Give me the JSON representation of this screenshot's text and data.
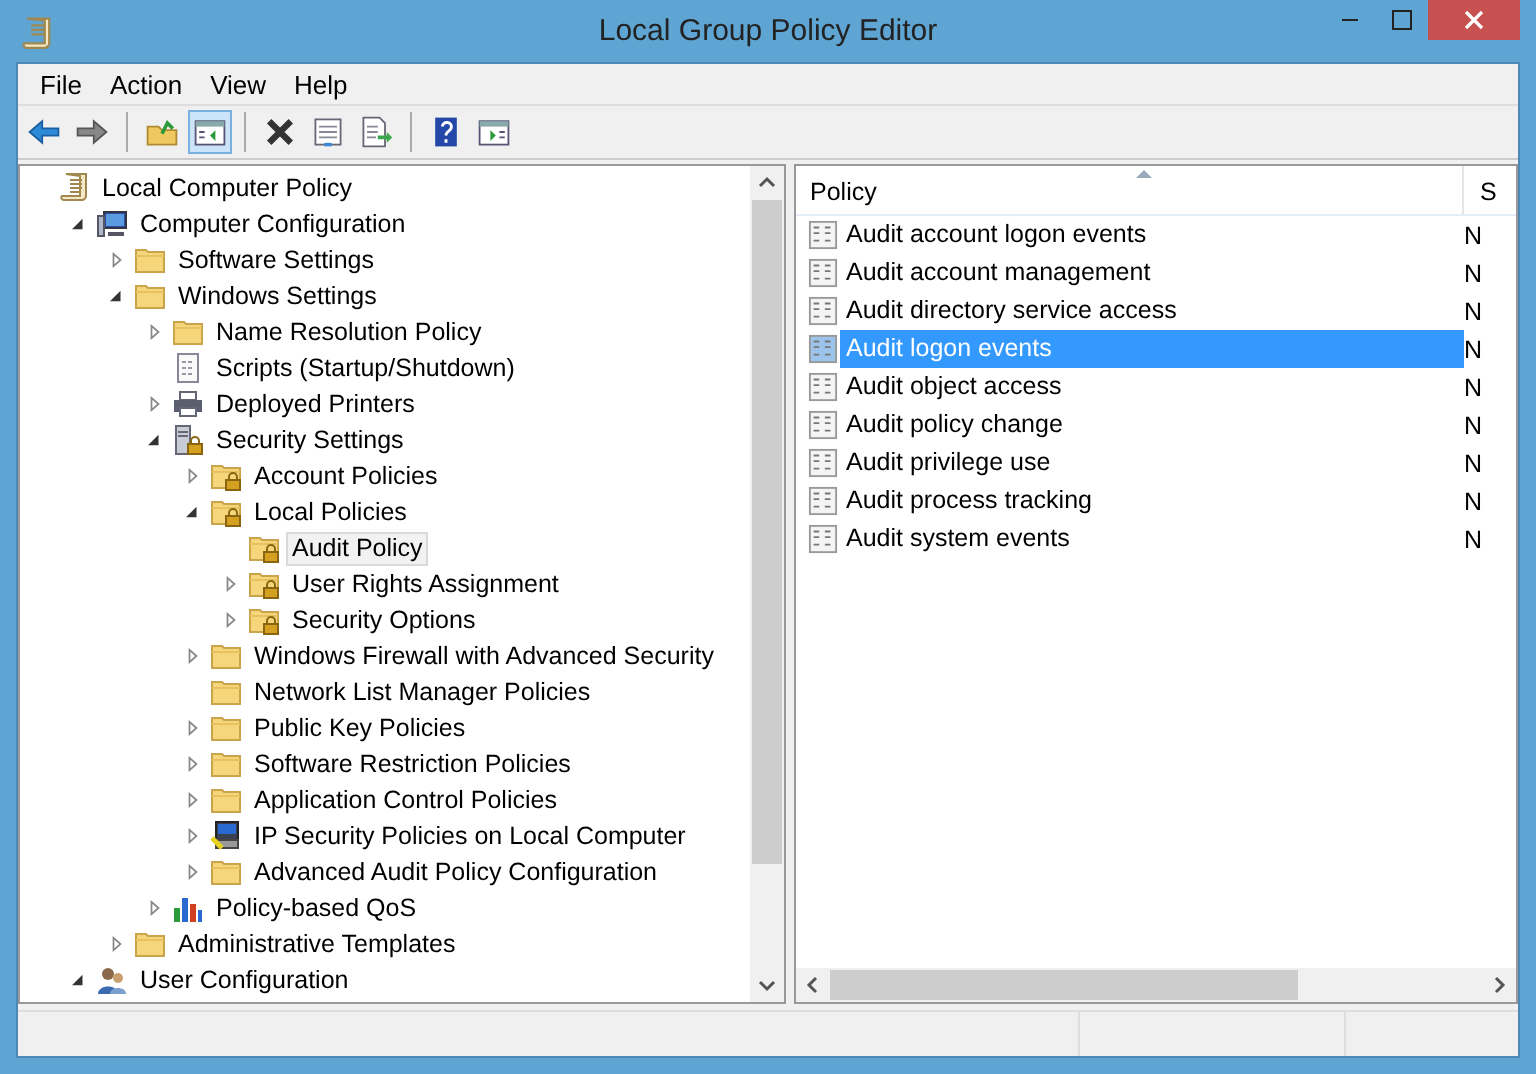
{
  "window": {
    "title": "Local Group Policy Editor"
  },
  "menu": [
    "File",
    "Action",
    "View",
    "Help"
  ],
  "toolbar": [
    {
      "kind": "back",
      "pressed": false
    },
    {
      "kind": "forward",
      "pressed": false
    },
    {
      "kind": "sep"
    },
    {
      "kind": "up",
      "pressed": false
    },
    {
      "kind": "tree",
      "pressed": true
    },
    {
      "kind": "sep"
    },
    {
      "kind": "delete",
      "pressed": false
    },
    {
      "kind": "properties",
      "pressed": false
    },
    {
      "kind": "export",
      "pressed": false
    },
    {
      "kind": "sep"
    },
    {
      "kind": "help",
      "pressed": false
    },
    {
      "kind": "action-pane",
      "pressed": false
    }
  ],
  "tree": [
    {
      "label": "Local Computer Policy",
      "kind": "scroll",
      "selected": false,
      "children": [
        {
          "label": "Computer Configuration",
          "kind": "computer",
          "expanded": true,
          "selected": false,
          "children": [
            {
              "label": "Software Settings",
              "kind": "folder",
              "expanded": false,
              "selected": false
            },
            {
              "label": "Windows Settings",
              "kind": "folder",
              "expanded": true,
              "selected": false,
              "children": [
                {
                  "label": "Name Resolution Policy",
                  "kind": "folder",
                  "expanded": false,
                  "selected": false
                },
                {
                  "label": "Scripts (Startup/Shutdown)",
                  "kind": "script",
                  "selected": false
                },
                {
                  "label": "Deployed Printers",
                  "kind": "printer",
                  "expanded": false,
                  "selected": false
                },
                {
                  "label": "Security Settings",
                  "kind": "security",
                  "expanded": true,
                  "selected": false,
                  "children": [
                    {
                      "label": "Account Policies",
                      "kind": "lock-folder",
                      "expanded": false,
                      "selected": false
                    },
                    {
                      "label": "Local Policies",
                      "kind": "lock-folder",
                      "expanded": true,
                      "selected": false,
                      "children": [
                        {
                          "label": "Audit Policy",
                          "kind": "lock-folder",
                          "selected": true
                        },
                        {
                          "label": "User Rights Assignment",
                          "kind": "lock-folder",
                          "expanded": false,
                          "selected": false
                        },
                        {
                          "label": "Security Options",
                          "kind": "lock-folder",
                          "expanded": false,
                          "selected": false
                        }
                      ]
                    },
                    {
                      "label": "Windows Firewall with Advanced Security",
                      "kind": "folder",
                      "expanded": false,
                      "selected": false
                    },
                    {
                      "label": "Network List Manager Policies",
                      "kind": "folder",
                      "selected": false
                    },
                    {
                      "label": "Public Key Policies",
                      "kind": "folder",
                      "expanded": false,
                      "selected": false
                    },
                    {
                      "label": "Software Restriction Policies",
                      "kind": "folder",
                      "expanded": false,
                      "selected": false
                    },
                    {
                      "label": "Application Control Policies",
                      "kind": "folder",
                      "expanded": false,
                      "selected": false
                    },
                    {
                      "label": "IP Security Policies on Local Computer",
                      "kind": "ipsec",
                      "expanded": false,
                      "selected": false
                    },
                    {
                      "label": "Advanced Audit Policy Configuration",
                      "kind": "folder",
                      "expanded": false,
                      "selected": false
                    }
                  ]
                },
                {
                  "label": "Policy-based QoS",
                  "kind": "qos",
                  "expanded": false,
                  "selected": false
                }
              ]
            },
            {
              "label": "Administrative Templates",
              "kind": "folder",
              "expanded": false,
              "selected": false
            }
          ]
        },
        {
          "label": "User Configuration",
          "kind": "user",
          "expanded": true,
          "selected": false
        }
      ]
    }
  ],
  "list": {
    "columns": [
      "Policy",
      "S"
    ],
    "rows": [
      {
        "policy": "Audit account logon events",
        "column_2": "N",
        "selected": false
      },
      {
        "policy": "Audit account management",
        "column_2": "N",
        "selected": false
      },
      {
        "policy": "Audit directory service access",
        "column_2": "N",
        "selected": false
      },
      {
        "policy": "Audit logon events",
        "column_2": "N",
        "selected": true
      },
      {
        "policy": "Audit object access",
        "column_2": "N",
        "selected": false
      },
      {
        "policy": "Audit policy change",
        "column_2": "N",
        "selected": false
      },
      {
        "policy": "Audit privilege use",
        "column_2": "N",
        "selected": false
      },
      {
        "policy": "Audit process tracking",
        "column_2": "N",
        "selected": false
      },
      {
        "policy": "Audit system events",
        "column_2": "N",
        "selected": false
      }
    ]
  }
}
